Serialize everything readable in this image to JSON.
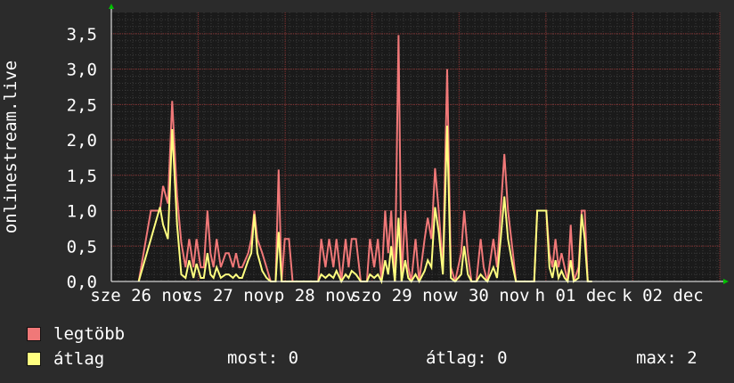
{
  "chart_data": {
    "type": "line",
    "ylabel": "onlinestream.live",
    "ylim": [
      0,
      3.8
    ],
    "y_ticks": [
      "0,0",
      "0,5",
      "1,0",
      "1,5",
      "2,0",
      "2,5",
      "3,0",
      "3,5"
    ],
    "x_ticks": [
      "sze 26 nov",
      "cs 27 nov",
      "p 28 nov",
      "szo 29 nov",
      "v 30 nov",
      "h 01 dec",
      "k 02 dec"
    ],
    "grid": true,
    "series": [
      {
        "name": "legtöbb",
        "color": "#f07878",
        "points": [
          [
            0.045,
            0
          ],
          [
            0.065,
            1
          ],
          [
            0.08,
            1
          ],
          [
            0.085,
            1.35
          ],
          [
            0.093,
            1.1
          ],
          [
            0.1,
            2.55
          ],
          [
            0.108,
            1.2
          ],
          [
            0.115,
            0.55
          ],
          [
            0.122,
            0.2
          ],
          [
            0.128,
            0.6
          ],
          [
            0.135,
            0.2
          ],
          [
            0.14,
            0.6
          ],
          [
            0.147,
            0.2
          ],
          [
            0.152,
            0.2
          ],
          [
            0.158,
            1.0
          ],
          [
            0.163,
            0.4
          ],
          [
            0.168,
            0.2
          ],
          [
            0.173,
            0.6
          ],
          [
            0.18,
            0.2
          ],
          [
            0.188,
            0.4
          ],
          [
            0.193,
            0.4
          ],
          [
            0.2,
            0.2
          ],
          [
            0.205,
            0.4
          ],
          [
            0.21,
            0.2
          ],
          [
            0.215,
            0.2
          ],
          [
            0.225,
            0.4
          ],
          [
            0.23,
            0.6
          ],
          [
            0.235,
            1.0
          ],
          [
            0.24,
            0.6
          ],
          [
            0.248,
            0.4
          ],
          [
            0.255,
            0.2
          ],
          [
            0.262,
            0
          ],
          [
            0.27,
            0
          ],
          [
            0.275,
            1.58
          ],
          [
            0.28,
            0
          ],
          [
            0.285,
            0.6
          ],
          [
            0.292,
            0.6
          ],
          [
            0.298,
            0
          ],
          [
            0.34,
            0
          ],
          [
            0.345,
            0.6
          ],
          [
            0.352,
            0.2
          ],
          [
            0.358,
            0.6
          ],
          [
            0.365,
            0.2
          ],
          [
            0.37,
            0.6
          ],
          [
            0.378,
            0
          ],
          [
            0.385,
            0.6
          ],
          [
            0.39,
            0.2
          ],
          [
            0.395,
            0.6
          ],
          [
            0.402,
            0.6
          ],
          [
            0.41,
            0
          ],
          [
            0.42,
            0
          ],
          [
            0.425,
            0.6
          ],
          [
            0.432,
            0.2
          ],
          [
            0.438,
            0.6
          ],
          [
            0.444,
            0
          ],
          [
            0.45,
            1.0
          ],
          [
            0.455,
            0.4
          ],
          [
            0.46,
            1.0
          ],
          [
            0.466,
            0
          ],
          [
            0.472,
            3.48
          ],
          [
            0.477,
            0
          ],
          [
            0.483,
            1.0
          ],
          [
            0.488,
            0.2
          ],
          [
            0.493,
            0
          ],
          [
            0.5,
            0.6
          ],
          [
            0.506,
            0
          ],
          [
            0.515,
            0.6
          ],
          [
            0.52,
            0.9
          ],
          [
            0.526,
            0.6
          ],
          [
            0.532,
            1.6
          ],
          [
            0.538,
            1.0
          ],
          [
            0.545,
            0.2
          ],
          [
            0.552,
            3.0
          ],
          [
            0.558,
            0.2
          ],
          [
            0.565,
            0
          ],
          [
            0.575,
            0.4
          ],
          [
            0.58,
            1.0
          ],
          [
            0.586,
            0.4
          ],
          [
            0.592,
            0
          ],
          [
            0.6,
            0
          ],
          [
            0.607,
            0.6
          ],
          [
            0.612,
            0.2
          ],
          [
            0.618,
            0
          ],
          [
            0.628,
            0.6
          ],
          [
            0.634,
            0.2
          ],
          [
            0.64,
            1.0
          ],
          [
            0.646,
            1.8
          ],
          [
            0.652,
            1.0
          ],
          [
            0.66,
            0.4
          ],
          [
            0.665,
            0
          ],
          [
            0.695,
            0
          ],
          [
            0.7,
            1.0
          ],
          [
            0.715,
            1.0
          ],
          [
            0.72,
            0.4
          ],
          [
            0.725,
            0.2
          ],
          [
            0.73,
            0.6
          ],
          [
            0.735,
            0.2
          ],
          [
            0.74,
            0.4
          ],
          [
            0.745,
            0.2
          ],
          [
            0.75,
            0
          ],
          [
            0.755,
            0.8
          ],
          [
            0.76,
            0
          ],
          [
            0.768,
            0.2
          ],
          [
            0.773,
            1.0
          ],
          [
            0.778,
            1.0
          ],
          [
            0.783,
            0
          ],
          [
            0.79,
            0
          ]
        ]
      },
      {
        "name": "átlag",
        "color": "#ffff80",
        "points": [
          [
            0.045,
            0
          ],
          [
            0.065,
            0.6
          ],
          [
            0.08,
            1.05
          ],
          [
            0.085,
            0.8
          ],
          [
            0.093,
            0.6
          ],
          [
            0.1,
            2.15
          ],
          [
            0.108,
            0.8
          ],
          [
            0.115,
            0.1
          ],
          [
            0.122,
            0.05
          ],
          [
            0.128,
            0.3
          ],
          [
            0.135,
            0.05
          ],
          [
            0.14,
            0.25
          ],
          [
            0.147,
            0.05
          ],
          [
            0.152,
            0.05
          ],
          [
            0.158,
            0.4
          ],
          [
            0.163,
            0.1
          ],
          [
            0.168,
            0.05
          ],
          [
            0.173,
            0.2
          ],
          [
            0.18,
            0.05
          ],
          [
            0.188,
            0.1
          ],
          [
            0.193,
            0.1
          ],
          [
            0.2,
            0.05
          ],
          [
            0.205,
            0.1
          ],
          [
            0.21,
            0.05
          ],
          [
            0.215,
            0.05
          ],
          [
            0.225,
            0.3
          ],
          [
            0.23,
            0.4
          ],
          [
            0.235,
            0.95
          ],
          [
            0.24,
            0.4
          ],
          [
            0.248,
            0.15
          ],
          [
            0.255,
            0.05
          ],
          [
            0.262,
            0
          ],
          [
            0.27,
            0
          ],
          [
            0.275,
            0.7
          ],
          [
            0.28,
            0
          ],
          [
            0.285,
            0
          ],
          [
            0.292,
            0
          ],
          [
            0.298,
            0
          ],
          [
            0.34,
            0
          ],
          [
            0.345,
            0.1
          ],
          [
            0.352,
            0.05
          ],
          [
            0.358,
            0.1
          ],
          [
            0.365,
            0.05
          ],
          [
            0.37,
            0.15
          ],
          [
            0.378,
            0
          ],
          [
            0.385,
            0.1
          ],
          [
            0.39,
            0.05
          ],
          [
            0.395,
            0.15
          ],
          [
            0.402,
            0.1
          ],
          [
            0.41,
            0
          ],
          [
            0.42,
            0
          ],
          [
            0.425,
            0.1
          ],
          [
            0.432,
            0.05
          ],
          [
            0.438,
            0.1
          ],
          [
            0.444,
            0
          ],
          [
            0.45,
            0.3
          ],
          [
            0.455,
            0.1
          ],
          [
            0.46,
            0.5
          ],
          [
            0.466,
            0
          ],
          [
            0.472,
            0.9
          ],
          [
            0.477,
            0
          ],
          [
            0.483,
            0.3
          ],
          [
            0.488,
            0.05
          ],
          [
            0.493,
            0
          ],
          [
            0.5,
            0.1
          ],
          [
            0.506,
            0
          ],
          [
            0.515,
            0.15
          ],
          [
            0.52,
            0.3
          ],
          [
            0.526,
            0.2
          ],
          [
            0.532,
            1.05
          ],
          [
            0.538,
            0.7
          ],
          [
            0.545,
            0.1
          ],
          [
            0.552,
            2.2
          ],
          [
            0.558,
            0.05
          ],
          [
            0.565,
            0
          ],
          [
            0.575,
            0.1
          ],
          [
            0.58,
            0.5
          ],
          [
            0.586,
            0.1
          ],
          [
            0.592,
            0
          ],
          [
            0.6,
            0
          ],
          [
            0.607,
            0.1
          ],
          [
            0.612,
            0.05
          ],
          [
            0.618,
            0
          ],
          [
            0.628,
            0.2
          ],
          [
            0.634,
            0.05
          ],
          [
            0.64,
            0.6
          ],
          [
            0.646,
            1.2
          ],
          [
            0.652,
            0.6
          ],
          [
            0.66,
            0.2
          ],
          [
            0.665,
            0
          ],
          [
            0.695,
            0
          ],
          [
            0.7,
            1.0
          ],
          [
            0.715,
            1.0
          ],
          [
            0.72,
            0.2
          ],
          [
            0.725,
            0.05
          ],
          [
            0.73,
            0.3
          ],
          [
            0.735,
            0.05
          ],
          [
            0.74,
            0.15
          ],
          [
            0.745,
            0.05
          ],
          [
            0.75,
            0
          ],
          [
            0.755,
            0.3
          ],
          [
            0.76,
            0
          ],
          [
            0.768,
            0.05
          ],
          [
            0.773,
            0.95
          ],
          [
            0.778,
            0.6
          ],
          [
            0.783,
            0
          ],
          [
            0.79,
            0
          ]
        ]
      }
    ]
  },
  "legend": {
    "max_label": "legtöbb",
    "avg_label": "átlag",
    "now_text": "most: 0",
    "avg_text": "átlag: 0",
    "max_text": "max: 2"
  }
}
